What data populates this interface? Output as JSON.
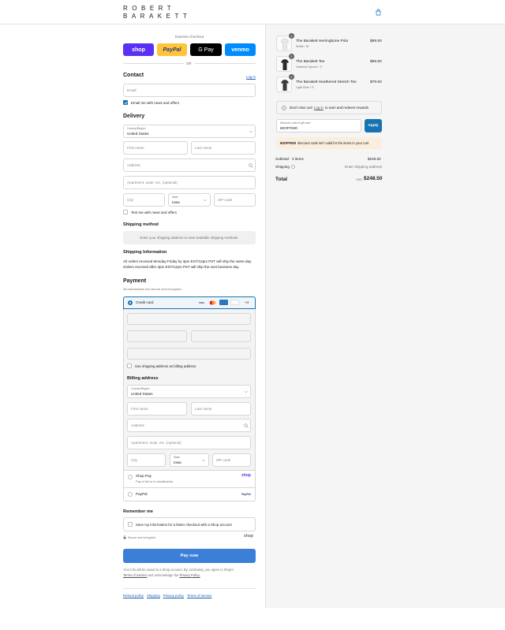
{
  "header": {
    "logo_line1": "ROBERT",
    "logo_line2": "BARAKETT",
    "cart_icon": "bag-icon"
  },
  "express": {
    "label": "Express checkout",
    "or": "OR",
    "shop": "shop",
    "paypal": "PayPal",
    "gpay": "G Pay",
    "venmo": "venmo"
  },
  "contact": {
    "title": "Contact",
    "login": "Log in",
    "email_placeholder": "Email",
    "news": "Email me with news and offers"
  },
  "delivery": {
    "title": "Delivery",
    "country_label": "Country/Region",
    "country": "United States",
    "first": "First name",
    "last": "Last name",
    "address": "Address",
    "apt": "Apartment, suite, etc. (optional)",
    "city": "City",
    "state_label": "State",
    "state": "Iowa",
    "zip": "ZIP code",
    "text_me": "Text me with news and offers"
  },
  "shipping_method": {
    "title": "Shipping method",
    "placeholder": "Enter your shipping address to view available shipping methods."
  },
  "shipping_info": {
    "title": "Shipping Information",
    "line1": "All orders received Monday-Friday by 3pm EST/12pm PST will ship the same day.",
    "line2": "Orders received after 3pm EST/12pm PST will ship the next business day."
  },
  "payment": {
    "title": "Payment",
    "sub": "All transactions are secure and encrypted.",
    "credit": "Credit card",
    "more": "+4",
    "use_shipping": "Use shipping address as billing address",
    "billing_title": "Billing address",
    "shop_pay": "Shop Pay",
    "shop_pay_sub": "Pay in full or in installments",
    "shop_logo": "shop",
    "paypal": "PayPal",
    "paypal_logo": "PayPal"
  },
  "billing": {
    "country_label": "Country/Region",
    "country": "United States",
    "first": "First name",
    "last": "Last name",
    "address": "Address",
    "apt": "Apartment, suite, etc. (optional)",
    "city": "City",
    "state_label": "State",
    "state": "Iowa",
    "zip": "ZIP code"
  },
  "remember": {
    "title": "Remember me",
    "save": "Save my information for a faster checkout with a Shop account",
    "secure": "Secure and encrypted",
    "shop": "shop"
  },
  "pay_now": "Pay now",
  "legal": {
    "l1": "Your info will be saved to a Shop account. By continuing, you agree to Shop's",
    "tos": "Terms of Service",
    "l2": "and acknowledge the",
    "privacy": "Privacy Policy."
  },
  "footer": {
    "links": [
      "Refund policy",
      "Shipping",
      "Privacy policy",
      "Terms of service"
    ]
  },
  "summary": {
    "items": [
      {
        "qty": "1",
        "name": "The Barakett Herringbone Polo",
        "variant": "White / M",
        "price": "$89.50"
      },
      {
        "qty": "1",
        "name": "The Barakett Tee",
        "variant": "Oatmeal Spruce / S",
        "price": "$69.50"
      },
      {
        "qty": "1",
        "name": "The Barakett Heathered Stretch Tee",
        "variant": "Light Blue / S",
        "price": "$79.50"
      }
    ],
    "notice_pre": "Don't miss out!",
    "notice_link": "Log in",
    "notice_post": "to earn and redeem rewards",
    "discount_label": "Discount code or gift card",
    "discount_value": "60OFF500",
    "apply": "Apply",
    "error_code": "60OFF500",
    "error_msg": "discount code isn't valid for the items in your cart",
    "subtotal_label": "Subtotal · 3 items",
    "subtotal": "$248.50",
    "shipping_label": "Shipping",
    "shipping_val": "Enter shipping address",
    "total_label": "Total",
    "currency": "USD",
    "total": "$248.50"
  },
  "colors": {
    "accent": "#1773b0",
    "shop": "#5a31f4",
    "paypal": "#ffc439",
    "venmo": "#008cff",
    "pay": "#3b7fd6"
  }
}
